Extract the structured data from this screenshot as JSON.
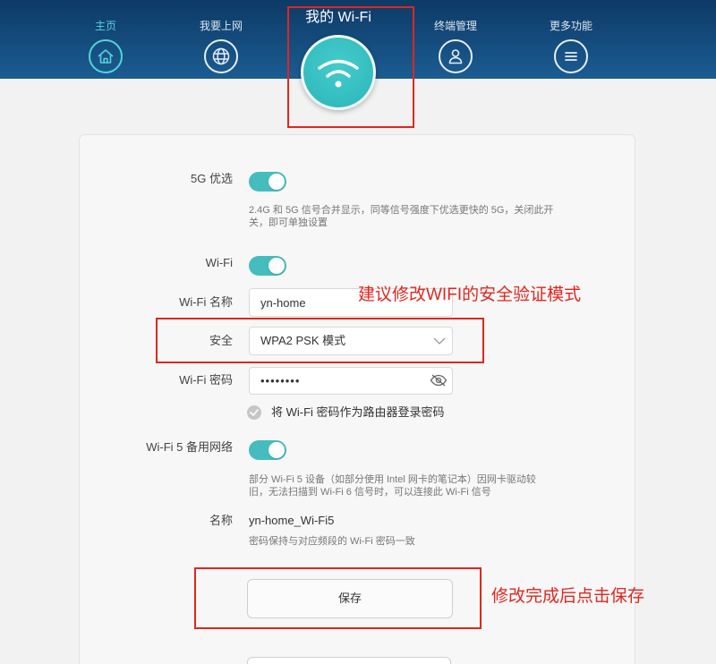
{
  "colors": {
    "accent": "#45bdbf",
    "nav_active": "#55d3da",
    "annotation_red": "#e0261f",
    "header_top": "#0d3a66",
    "header_bottom": "#1b5c92"
  },
  "header": {
    "nav": [
      {
        "label": "主页",
        "icon": "home-icon",
        "active": true
      },
      {
        "label": "我要上网",
        "icon": "globe-icon",
        "active": false
      },
      {
        "label": "我的 Wi-Fi",
        "icon": "wifi-icon",
        "active": false
      },
      {
        "label": "终端管理",
        "icon": "user-icon",
        "active": false
      },
      {
        "label": "更多功能",
        "icon": "menu-icon",
        "active": false
      }
    ]
  },
  "settings": {
    "pref_5g": {
      "label": "5G 优选",
      "enabled": true,
      "description": [
        "2.4G 和 5G 信号合并显示，同等信号强度下优选更快的 5G，关闭此开",
        "关，即可单独设置"
      ]
    },
    "wifi": {
      "label": "Wi-Fi",
      "enabled": true
    },
    "wifi_name": {
      "label": "Wi-Fi 名称",
      "value": "yn-home"
    },
    "security": {
      "label": "安全",
      "value": "WPA2 PSK 模式"
    },
    "wifi_password": {
      "label": "Wi-Fi 密码",
      "value": "••••••••",
      "icon": "eye-off-icon"
    },
    "use_as_login": {
      "label": "将 Wi-Fi 密码作为路由器登录密码",
      "checked": false
    },
    "wifi5_backup": {
      "label": "Wi-Fi 5 备用网络",
      "enabled": true,
      "description": [
        "部分 Wi-Fi 5 设备（如部分使用 Intel 网卡的笔记本）因网卡驱动较",
        "旧，无法扫描到 Wi-Fi 6 信号时，可以连接此 Wi-Fi 信号"
      ]
    },
    "wifi5_name": {
      "label": "名称",
      "value": "yn-home_Wi-Fi5",
      "note": "密码保持与对应频段的 Wi-Fi 密码一致"
    }
  },
  "actions": {
    "save_label": "保存"
  },
  "annotations": {
    "security_hint": "建议修改WIFI的安全验证模式",
    "save_hint": "修改完成后点击保存"
  }
}
